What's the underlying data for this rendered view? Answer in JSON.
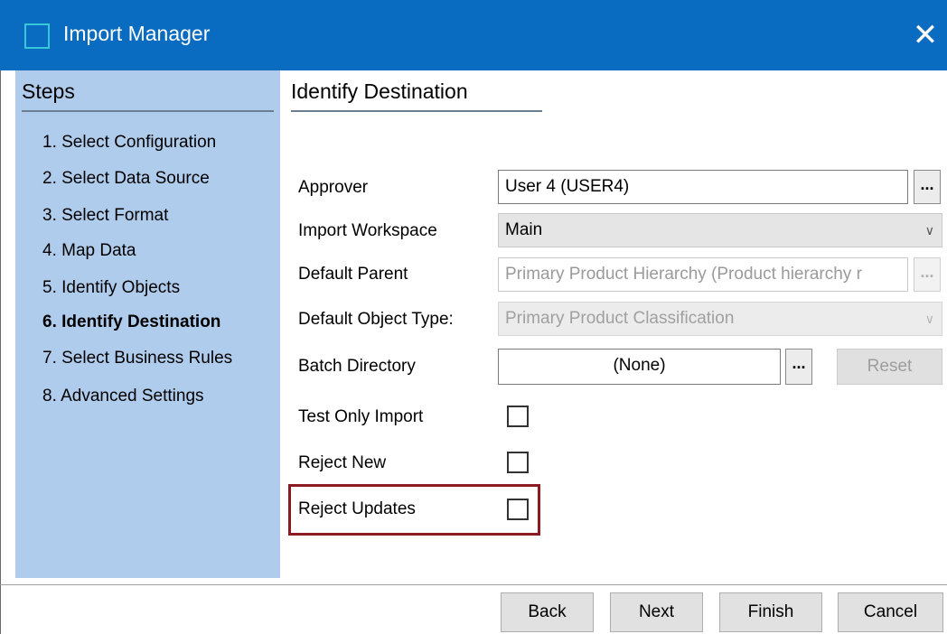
{
  "window": {
    "title": "Import Manager",
    "close_glyph": "✕"
  },
  "steps": {
    "heading": "Steps",
    "items": [
      {
        "label": "1. Select Configuration",
        "current": false
      },
      {
        "label": "2. Select Data Source",
        "current": false
      },
      {
        "label": "3. Select Format",
        "current": false
      },
      {
        "label": "4. Map Data",
        "current": false
      },
      {
        "label": "5. Identify Objects",
        "current": false
      },
      {
        "label": "6. Identify Destination",
        "current": true
      },
      {
        "label": "7. Select Business Rules",
        "current": false
      },
      {
        "label": "8. Advanced Settings",
        "current": false
      }
    ]
  },
  "content": {
    "heading": "Identify Destination",
    "approver": {
      "label": "Approver",
      "value": "User 4 (USER4)",
      "browse": "..."
    },
    "import_workspace": {
      "label": "Import Workspace",
      "value": "Main",
      "enabled": true
    },
    "default_parent": {
      "label": "Default Parent",
      "value": "Primary Product Hierarchy (Product hierarchy r",
      "browse": "...",
      "enabled": false
    },
    "default_object_type": {
      "label": "Default Object Type:",
      "value": "Primary Product Classification",
      "enabled": false
    },
    "batch_directory": {
      "label": "Batch Directory",
      "value": "(None)",
      "browse": "...",
      "reset": "Reset",
      "reset_enabled": false
    },
    "test_only_import": {
      "label": "Test Only Import",
      "checked": false
    },
    "reject_new": {
      "label": "Reject New",
      "checked": false
    },
    "reject_updates": {
      "label": "Reject Updates",
      "checked": false,
      "highlighted": true
    },
    "dropdown_arrow": "∨"
  },
  "footer": {
    "back": "Back",
    "next": "Next",
    "finish": "Finish",
    "cancel": "Cancel"
  },
  "colors": {
    "titlebar": "#0a6cc1",
    "steps_panel": "#b0ccec",
    "highlight": "#8b1a23"
  }
}
